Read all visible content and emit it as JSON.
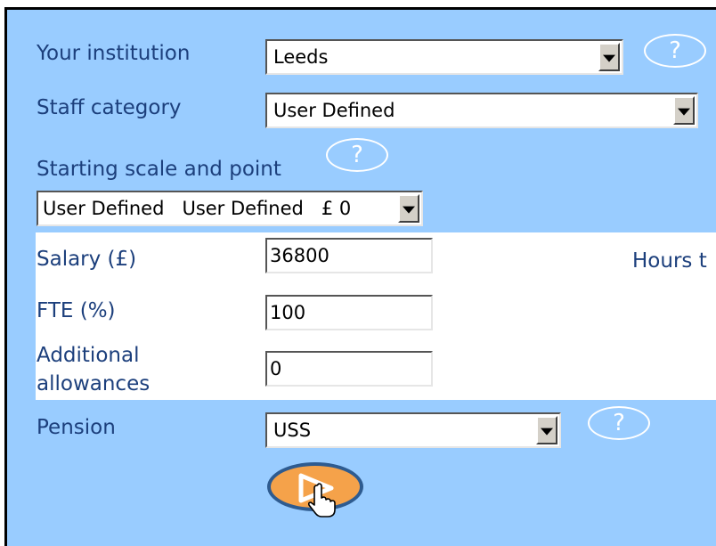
{
  "form": {
    "institution": {
      "label": "Your institution",
      "value": "Leeds"
    },
    "staff_category": {
      "label": "Staff category",
      "value": "User Defined"
    },
    "starting_scale": {
      "label": "Starting scale and point",
      "value": "User Defined   User Defined   £ 0"
    },
    "salary": {
      "label": "Salary (£)",
      "value": "36800"
    },
    "fte": {
      "label": "FTE (%)",
      "value": "100"
    },
    "allowances": {
      "label_line1": "Additional",
      "label_line2": "allowances",
      "value": "0"
    },
    "pension": {
      "label": "Pension",
      "value": "USS"
    },
    "hours_label": "Hours t",
    "help_glyph": "?",
    "submit_icon": "play-arrow-icon"
  },
  "colors": {
    "panel_background": "#99ccff",
    "label_text": "#1c3f7c",
    "submit_fill": "#f5a24a",
    "submit_border": "#2e5b90"
  }
}
